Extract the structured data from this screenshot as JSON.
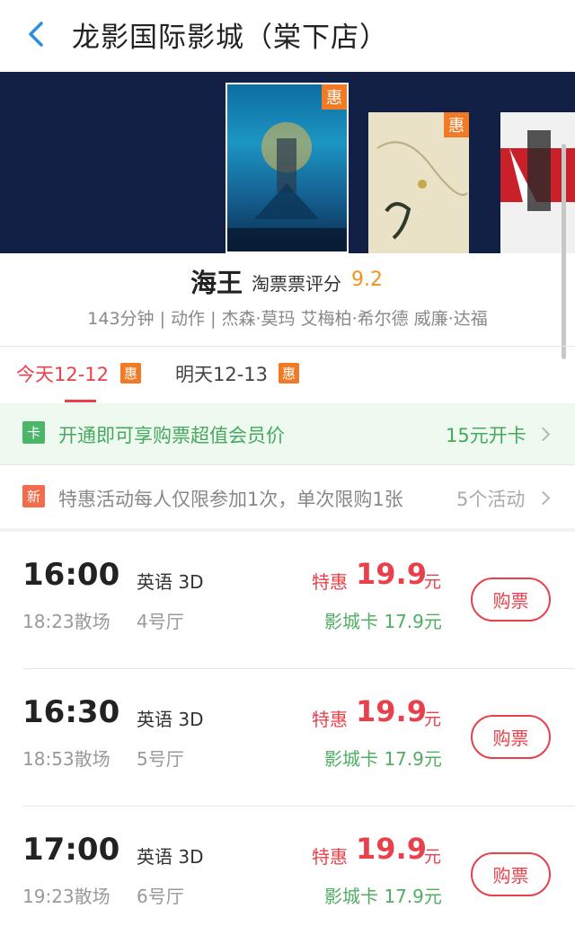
{
  "header": {
    "title": "龙影国际影城（棠下店）"
  },
  "banner": {
    "posters": [
      {
        "tag": "惠"
      },
      {
        "tag": "惠"
      },
      {
        "tag": ""
      }
    ]
  },
  "movie": {
    "name": "海王",
    "rating_label": "淘票票评分",
    "rating": "9.2",
    "meta": "143分钟 | 动作 | 杰森·莫玛 艾梅柏·希尔德 威廉·达福"
  },
  "date_tabs": [
    {
      "label": "今天12-12",
      "tag": "惠"
    },
    {
      "label": "明天12-13",
      "tag": "惠"
    }
  ],
  "member": {
    "badge": "卡",
    "text": "开通即可享购票超值会员价",
    "price": "15元开卡"
  },
  "promo": {
    "badge": "新",
    "text": "特惠活动每人仅限参加1次，单次限购1张",
    "count": "5个活动"
  },
  "showtimes": [
    {
      "start": "16:00",
      "end": "18:23散场",
      "lang": "英语 3D",
      "hall": "4号厅",
      "label": "特惠",
      "price": "19.9",
      "unit": "元",
      "card_price": "影城卡 17.9元",
      "button": "购票"
    },
    {
      "start": "16:30",
      "end": "18:53散场",
      "lang": "英语 3D",
      "hall": "5号厅",
      "label": "特惠",
      "price": "19.9",
      "unit": "元",
      "card_price": "影城卡 17.9元",
      "button": "购票"
    },
    {
      "start": "17:00",
      "end": "19:23散场",
      "lang": "英语 3D",
      "hall": "6号厅",
      "label": "特惠",
      "price": "19.9",
      "unit": "元",
      "card_price": "影城卡 17.9元",
      "button": "购票"
    }
  ],
  "colors": {
    "accent": "#e8414b",
    "rating": "#f0941e",
    "member_green": "#47a85e",
    "tag_orange": "#f07a26",
    "banner_bg": "#132046"
  }
}
